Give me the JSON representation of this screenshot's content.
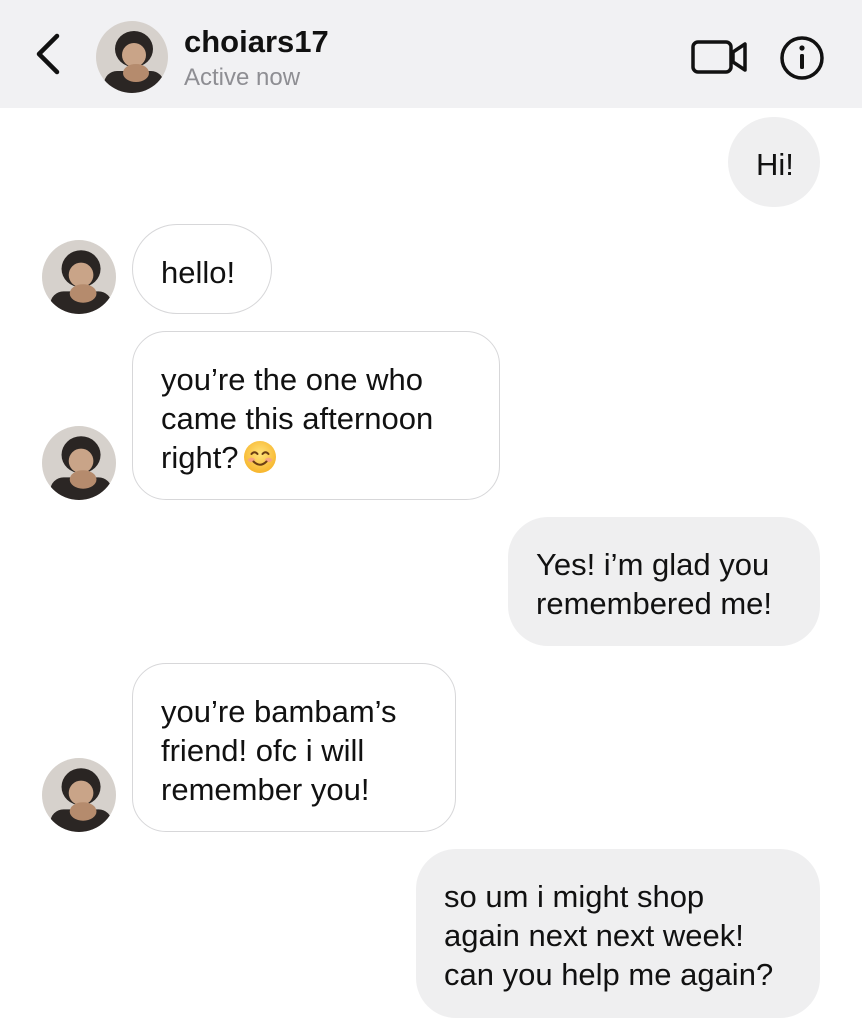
{
  "header": {
    "back_icon": "chevron-left-icon",
    "username": "choiars17",
    "status": "Active now",
    "video_icon": "video-camera-icon",
    "info_icon": "info-icon"
  },
  "messages": [
    {
      "direction": "outgoing",
      "lines": [
        "Hi!"
      ]
    },
    {
      "direction": "incoming",
      "lines": [
        "hello!"
      ]
    },
    {
      "direction": "incoming",
      "lines": [
        "you’re the one who",
        "came this afternoon",
        "right?"
      ],
      "emoji": "smiling-face-emoji"
    },
    {
      "direction": "outgoing",
      "lines": [
        "Yes! i’m glad you",
        "remembered me!"
      ]
    },
    {
      "direction": "incoming",
      "lines": [
        "you’re bambam’s",
        "friend! ofc i will",
        "remember you!"
      ]
    },
    {
      "direction": "outgoing",
      "lines": [
        "so um i might shop",
        "again next next week!",
        "can you help me again?"
      ]
    }
  ],
  "colors": {
    "header_bg": "#f1f1f3",
    "outgoing_bubble": "#efeff0",
    "incoming_border": "#d7d7d9",
    "status_text": "#8e8e93"
  }
}
